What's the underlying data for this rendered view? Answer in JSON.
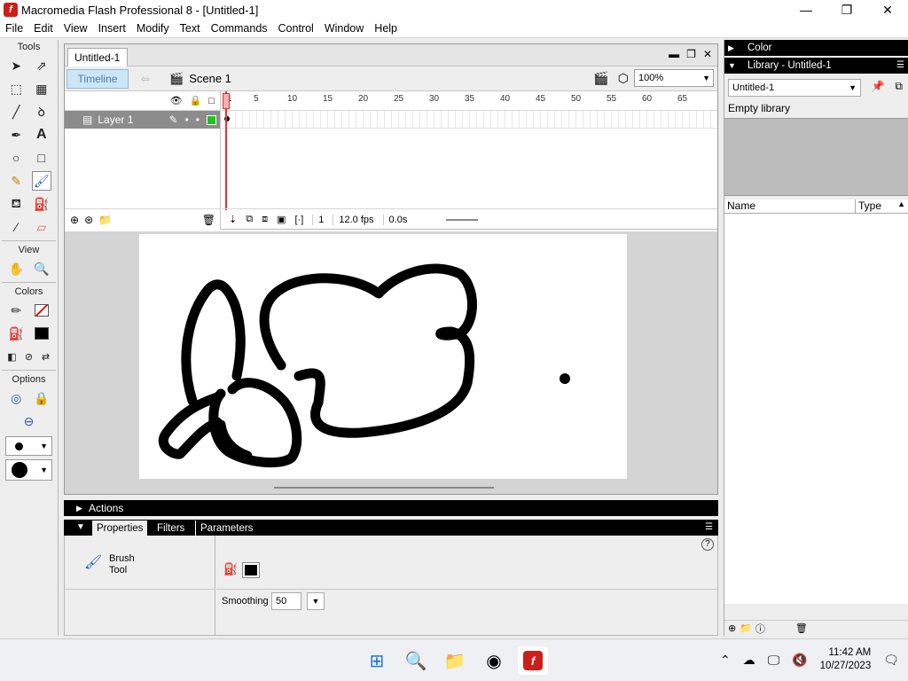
{
  "window": {
    "title": "Macromedia Flash Professional 8 - [Untitled-1]",
    "minimize": "—",
    "restore": "❐",
    "close": "✕"
  },
  "menu": [
    "File",
    "Edit",
    "View",
    "Insert",
    "Modify",
    "Text",
    "Commands",
    "Control",
    "Window",
    "Help"
  ],
  "tools": {
    "header": "Tools",
    "view_header": "View",
    "colors_header": "Colors",
    "options_header": "Options"
  },
  "document": {
    "tab": "Untitled-1",
    "timeline_button": "Timeline",
    "scene": "Scene 1",
    "zoom": "100%",
    "layer_name": "Layer 1",
    "ruler_ticks": [
      "1",
      "5",
      "10",
      "15",
      "20",
      "25",
      "30",
      "35",
      "40",
      "45",
      "50",
      "55",
      "60",
      "65"
    ],
    "frame": "1",
    "fps": "12.0 fps",
    "time": "0.0s"
  },
  "panels": {
    "actions": "Actions",
    "tabs": [
      "Properties",
      "Filters",
      "Parameters"
    ],
    "tool_name_line1": "Brush",
    "tool_name_line2": "Tool",
    "smoothing_label": "Smoothing",
    "smoothing_value": "50",
    "help": "?"
  },
  "right": {
    "color_header": "Color",
    "library_header": "Library - Untitled-1",
    "library_select": "Untitled-1",
    "empty_library": "Empty library",
    "col_name": "Name",
    "col_type": "Type"
  },
  "taskbar": {
    "time": "11:42 AM",
    "date": "10/27/2023"
  },
  "colors": {
    "fill": "#000000",
    "stroke": "#000000",
    "layer_box": "#20c020"
  }
}
